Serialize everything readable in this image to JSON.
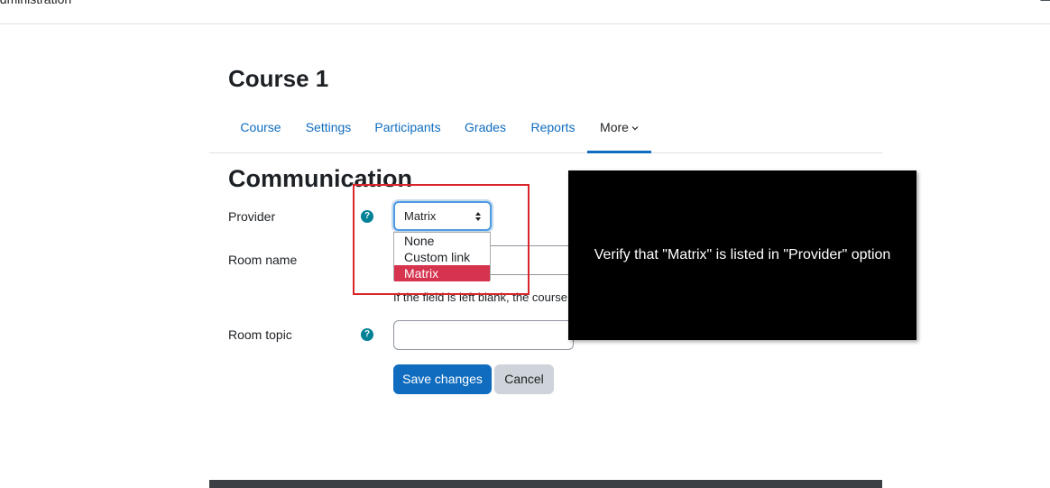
{
  "topbar": {
    "breadcrumb": "administration"
  },
  "page": {
    "title": "Course 1"
  },
  "nav": {
    "tabs": [
      {
        "label": "Course"
      },
      {
        "label": "Settings"
      },
      {
        "label": "Participants"
      },
      {
        "label": "Grades"
      },
      {
        "label": "Reports"
      },
      {
        "label": "More"
      }
    ]
  },
  "form": {
    "heading": "Communication",
    "provider": {
      "label": "Provider",
      "selected": "Matrix",
      "options": [
        "None",
        "Custom link",
        "Matrix"
      ]
    },
    "room_name": {
      "label": "Room name",
      "value": "",
      "hint": "If the field is left blank, the course"
    },
    "room_topic": {
      "label": "Room topic",
      "value": ""
    },
    "save_label": "Save changes",
    "cancel_label": "Cancel"
  },
  "overlay": {
    "text": "Verify that \"Matrix\" is listed in \"Provider\" option"
  },
  "colors": {
    "primary": "#0f6cbf",
    "help": "#008196",
    "selected_option": "#d5334e",
    "annotation": "#d9262b"
  }
}
